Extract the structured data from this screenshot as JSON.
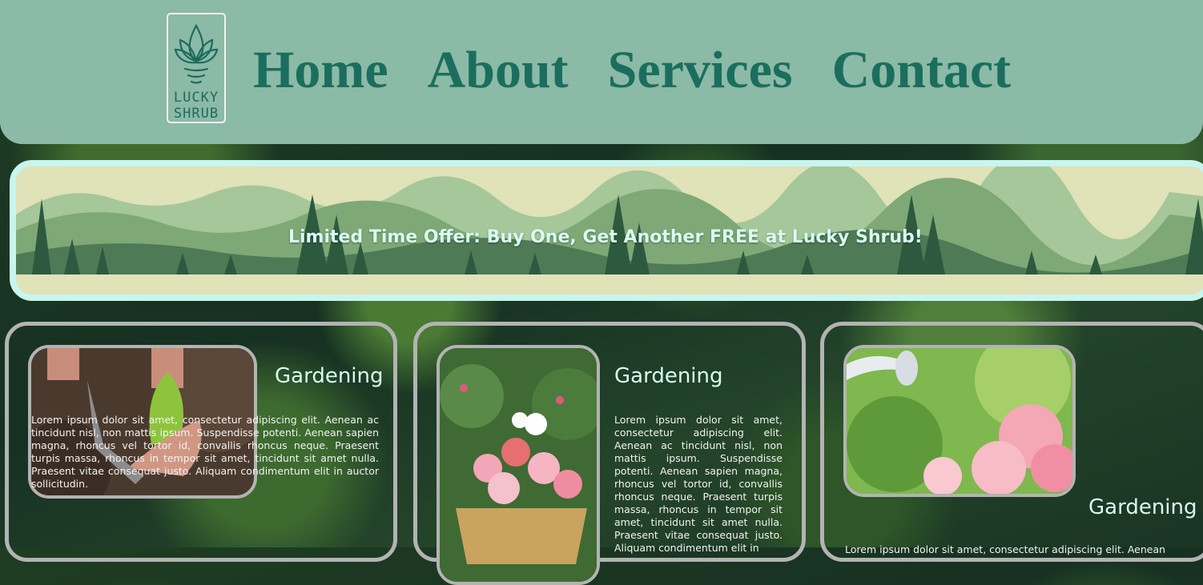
{
  "logo": {
    "line1": "LUCKY",
    "line2": "SHRUB"
  },
  "nav": [
    "Home",
    "About",
    "Services",
    "Contact"
  ],
  "banner": {
    "text": "Limited Time Offer: Buy One, Get Another FREE at Lucky Shrub!"
  },
  "cards": [
    {
      "title": "Gardening",
      "text": "Lorem ipsum dolor sit amet, consectetur adipiscing elit. Aenean ac tincidunt nisl, non mattis ipsum. Suspendisse potenti. Aenean sapien magna, rhoncus vel tortor id, convallis rhoncus neque. Praesent turpis massa, rhoncus in tempor sit amet, tincidunt sit amet nulla. Praesent vitae consequat justo. Aliquam condimentum elit in auctor sollicitudin."
    },
    {
      "title": "Gardening",
      "text": "Lorem ipsum dolor sit amet, consectetur adipiscing elit. Aenean ac tincidunt nisl, non mattis ipsum. Suspendisse potenti. Aenean sapien magna, rhoncus vel tortor id, convallis rhoncus neque. Praesent turpis massa, rhoncus in tempor sit amet, tincidunt sit amet nulla. Praesent vitae consequat justo. Aliquam condimentum elit in"
    },
    {
      "title": "Gardening",
      "text": "Lorem ipsum dolor sit amet, consectetur adipiscing elit. Aenean"
    }
  ],
  "colors": {
    "header": "#8bbaa7",
    "nav_text": "#1b6e5e",
    "banner_border": "#c8f5ee",
    "card_border": "#b3b3b3"
  }
}
